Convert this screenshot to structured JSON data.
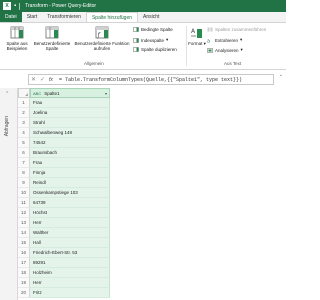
{
  "window": {
    "title": "Transform - Power Query-Editor",
    "app_badge": "X"
  },
  "tabs": [
    "Datei",
    "Start",
    "Transformieren",
    "Spalte hinzufügen",
    "Ansicht"
  ],
  "active_tab": "Spalte hinzufügen",
  "ribbon": {
    "group_allgemein": "Allgemein",
    "group_text": "Aus Text",
    "btn_beispiele": "Spalte aus Beispielen",
    "btn_benutzerdef_spalte": "Benutzerdefinierte Spalte",
    "btn_benutzerdef_funktion": "Benutzerdefinierte Funktion aufrufen",
    "btn_bedingte": "Bedingte Spalte",
    "btn_index": "Indexspalte",
    "btn_duplizieren": "Spalte duplizieren",
    "btn_format": "Format",
    "btn_zusammen": "Spalten zusammenführen",
    "btn_extrahieren": "Extrahieren",
    "btn_analysieren": "Analysieren"
  },
  "formula": {
    "text": "= Table.TransformColumnTypes(Quelle,{{\"Spalte1\", type text}})",
    "fx": "fx"
  },
  "queries_label": "Abfragen",
  "grid": {
    "column_header": "Spalte1",
    "column_type": "ABC",
    "rows": [
      {
        "n": "1",
        "v": "Frau"
      },
      {
        "n": "2",
        "v": "Joelina"
      },
      {
        "n": "3",
        "v": "Strahl"
      },
      {
        "n": "4",
        "v": "Schwalbenweg 148"
      },
      {
        "n": "5",
        "v": "74542"
      },
      {
        "n": "6",
        "v": "Braunsbach"
      },
      {
        "n": "7",
        "v": "Frau"
      },
      {
        "n": "8",
        "v": "Finnja"
      },
      {
        "n": "9",
        "v": "Reindl"
      },
      {
        "n": "10",
        "v": "Ossenkampstiege 103"
      },
      {
        "n": "11",
        "v": "64739"
      },
      {
        "n": "12",
        "v": "Höchst"
      },
      {
        "n": "13",
        "v": "Herr"
      },
      {
        "n": "14",
        "v": "Walther"
      },
      {
        "n": "15",
        "v": "Hall"
      },
      {
        "n": "16",
        "v": "Friedrich-Ebert-Str. 53"
      },
      {
        "n": "17",
        "v": "89291"
      },
      {
        "n": "18",
        "v": "Holzheim"
      },
      {
        "n": "19",
        "v": "Herr"
      },
      {
        "n": "20",
        "v": "Fritz"
      }
    ]
  }
}
